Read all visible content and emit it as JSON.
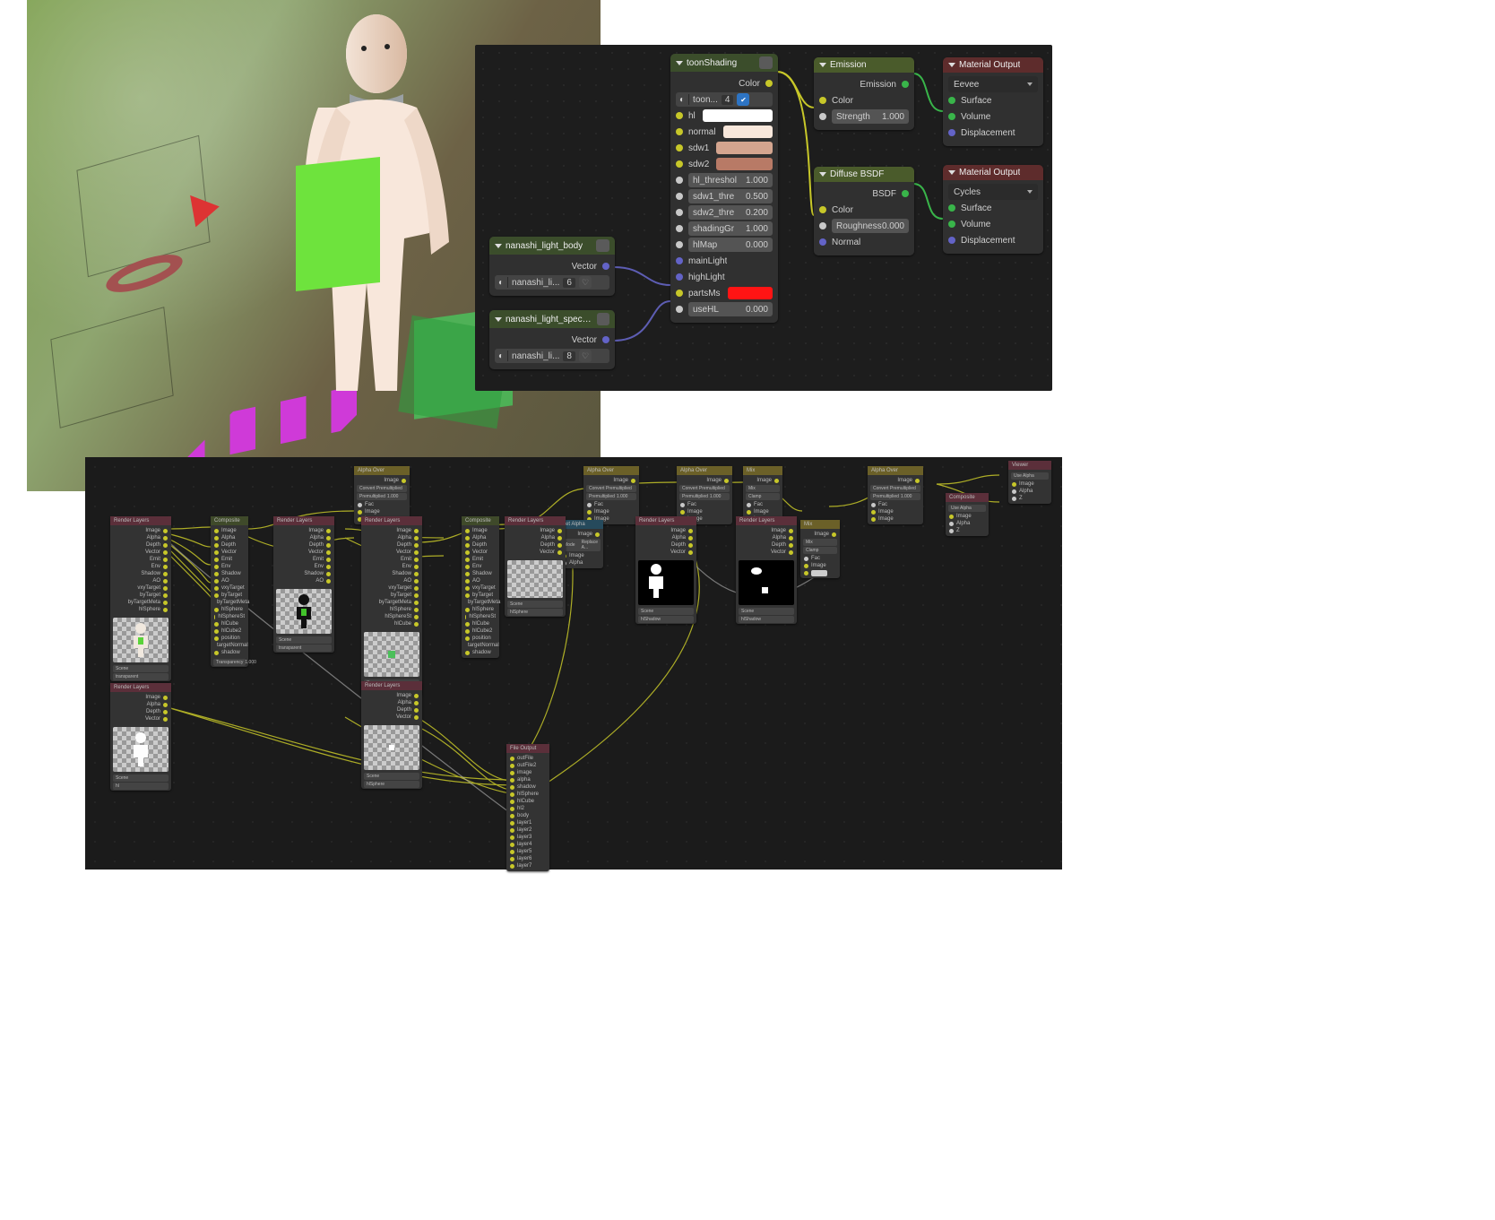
{
  "viewport": {
    "description": "3D viewport render with toon-shaded mannequin, collar, green cube, green chest plane, red cone, red torus, magenta checker floor, two camera/empty wireframes"
  },
  "shader_nodes": {
    "light_body": {
      "title": "nanashi_light_body",
      "datablock": "nanashi_li...",
      "users": "6",
      "outputs": [
        "Vector"
      ]
    },
    "light_spec": {
      "title": "nanashi_light_specular",
      "datablock": "nanashi_li...",
      "users": "8",
      "outputs": [
        "Vector"
      ]
    },
    "toon": {
      "title": "toonShading",
      "datablock": "toon...",
      "users": "4",
      "output": "Color",
      "hl": {
        "label": "hl",
        "color": "#ffffff"
      },
      "normal": {
        "label": "normal",
        "color": "#f8e7db"
      },
      "sdw1": {
        "label": "sdw1",
        "color": "#d4a58f"
      },
      "sdw2": {
        "label": "sdw2",
        "color": "#b87a66"
      },
      "hl_th": {
        "label": "hl_threshol",
        "value": "1.000"
      },
      "sdw1_th": {
        "label": "sdw1_thre",
        "value": "0.500"
      },
      "sdw2_th": {
        "label": "sdw2_thre",
        "value": "0.200"
      },
      "grad": {
        "label": "shadingGr",
        "value": "1.000"
      },
      "hlmap": {
        "label": "hlMap",
        "value": "0.000"
      },
      "mainLight": "mainLight",
      "highLight": "highLight",
      "partsMs": {
        "label": "partsMs",
        "color": "#ff1414"
      },
      "useHL": {
        "label": "useHL",
        "value": "0.000"
      }
    },
    "emission": {
      "title": "Emission",
      "output": "Emission",
      "color": "Color",
      "strength": {
        "label": "Strength",
        "value": "1.000"
      }
    },
    "diffuse": {
      "title": "Diffuse BSDF",
      "output": "BSDF",
      "color": "Color",
      "roughness": {
        "label": "Roughness",
        "value": "0.000"
      },
      "normal": "Normal"
    },
    "mat_out_eevee": {
      "title": "Material Output",
      "target": "Eevee",
      "surface": "Surface",
      "volume": "Volume",
      "disp": "Displacement"
    },
    "mat_out_cycles": {
      "title": "Material Output",
      "target": "Cycles",
      "surface": "Surface",
      "volume": "Volume",
      "disp": "Displacement"
    }
  },
  "compositor_nodes": {
    "rlayer_labels": [
      "Image",
      "Alpha",
      "Depth",
      "Vector",
      "Emit",
      "Env",
      "Shadow",
      "AO",
      "vxyTarget",
      "byTarget",
      "byTargetMeta",
      "hlSphere",
      "hlSphereSt",
      "hlCube",
      "hlCube2",
      "position",
      "targetNormal",
      "shadow"
    ],
    "rlayer_short": [
      "Image",
      "Alpha",
      "Depth",
      "Vector"
    ],
    "headers": {
      "render_layers": "Render Layers",
      "composite": "Composite",
      "alpha_over": "Alpha Over",
      "set_alpha": "Set Alpha",
      "mix": "Mix",
      "viewer": "Viewer",
      "file_output": "File Output"
    },
    "small_outs": [
      "Image",
      "Alpha"
    ],
    "alpha_over_rows": {
      "out": "Image",
      "convert": "Convert Premultiplied",
      "premul": {
        "label": "Premultiplied",
        "value": "1.000"
      },
      "fac": "Fac",
      "img1": "Image",
      "img2": "Image"
    },
    "set_alpha_rows": {
      "out": "Image",
      "mode": {
        "label": "Mode",
        "value": "Replace A..."
      },
      "img": "Image",
      "alpha": "Alpha"
    },
    "mix_rows": {
      "out": "Image",
      "blend": "Mix",
      "clamp": "Clamp",
      "fac": "Fac",
      "img1": "Image",
      "img2": "Image"
    },
    "viewer_rows": {
      "usealpha": "Use Alpha",
      "img": "Image",
      "alpha": "Alpha",
      "z": "Z"
    },
    "composite_rows": {
      "usealpha": "Use Alpha",
      "img": "Image",
      "alpha": "Alpha",
      "z": "Z"
    },
    "scene_dropdown": "Scene",
    "layer_dropdown_values": [
      "transparent",
      "transparent",
      "hlSphere",
      "hlSphere",
      "hl",
      "hlShadow",
      "hlShadow"
    ],
    "transparency_slider": {
      "label": "Transparency",
      "value": "1.000"
    },
    "file_output_rows": [
      "outFile",
      "outFile2",
      "image",
      "alpha",
      "shadow",
      "hlSphere",
      "hlCube",
      "hl2",
      "body",
      "layer1",
      "layer2",
      "layer3",
      "layer4",
      "layer5",
      "layer6",
      "layer7"
    ]
  }
}
